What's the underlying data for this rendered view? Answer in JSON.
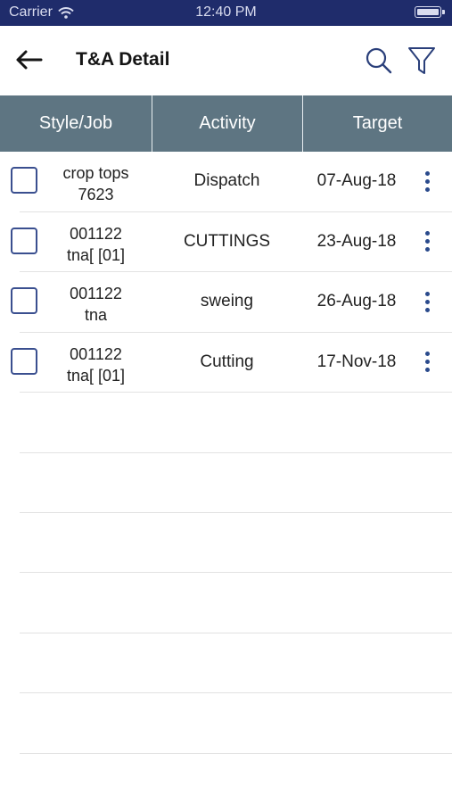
{
  "status_bar": {
    "carrier": "Carrier",
    "time": "12:40 PM"
  },
  "nav": {
    "title": "T&A Detail",
    "back_icon": "arrow-left-icon",
    "search_icon": "search-icon",
    "filter_icon": "filter-icon"
  },
  "table": {
    "headers": [
      "Style/Job",
      "Activity",
      "Target"
    ],
    "rows": [
      {
        "style": "crop tops",
        "job": "7623",
        "activity": "Dispatch",
        "target": "07-Aug-18"
      },
      {
        "style": "001122",
        "job": "tna[ [01]",
        "activity": "CUTTINGS",
        "target": "23-Aug-18"
      },
      {
        "style": "001122",
        "job": "tna",
        "activity": "sweing",
        "target": "26-Aug-18"
      },
      {
        "style": "001122",
        "job": "tna[ [01]",
        "activity": "Cutting",
        "target": "17-Nov-18"
      }
    ]
  },
  "colors": {
    "status_bar": "#1f2c6b",
    "table_header": "#5e7582",
    "accent": "#3a4f8f"
  }
}
